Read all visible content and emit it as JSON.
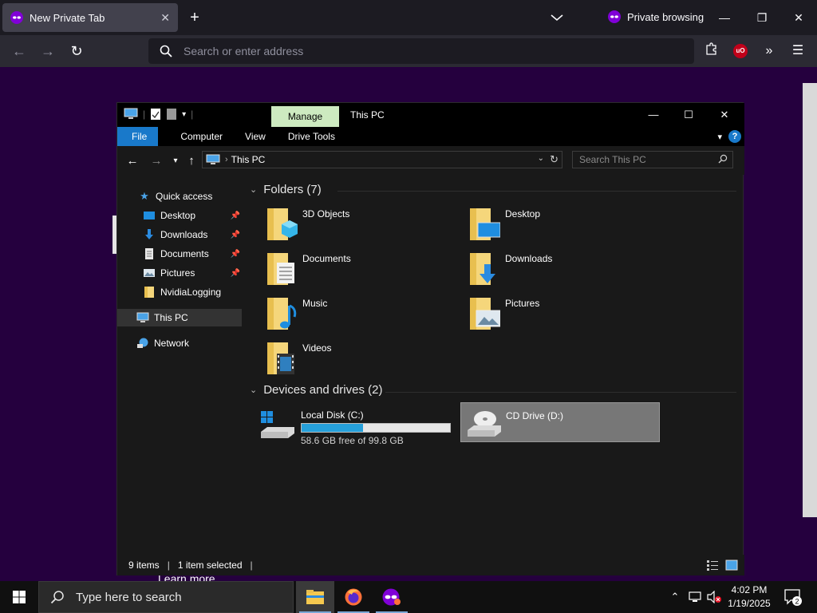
{
  "firefox": {
    "tab_title": "New Private Tab",
    "private_label": "Private browsing",
    "url_placeholder": "Search or enter address",
    "page_text": "Learn more",
    "ublock_badge": "uO"
  },
  "explorer": {
    "ribbon_context_tab": "Manage",
    "window_title": "This PC",
    "ribbon_tabs": [
      "File",
      "Computer",
      "View",
      "Drive Tools"
    ],
    "address_crumb": "This PC",
    "search_placeholder": "Search This PC",
    "nav": {
      "quick_access": "Quick access",
      "desktop": "Desktop",
      "downloads": "Downloads",
      "documents": "Documents",
      "pictures": "Pictures",
      "nvidia": "NvidiaLogging",
      "this_pc": "This PC",
      "network": "Network"
    },
    "folders_header": "Folders (7)",
    "folders": [
      "3D Objects",
      "Desktop",
      "Documents",
      "Downloads",
      "Music",
      "Pictures",
      "Videos"
    ],
    "devices_header": "Devices and drives (2)",
    "drives": {
      "c_name": "Local Disk (C:)",
      "c_free": "58.6 GB free of 99.8 GB",
      "c_used_fraction": 0.413,
      "d_name": "CD Drive (D:)"
    },
    "status": {
      "items": "9 items",
      "selected": "1 item selected"
    }
  },
  "taskbar": {
    "search_text": "Type here to search",
    "time": "4:02 PM",
    "date": "1/19/2025",
    "notification_count": "2"
  },
  "colors": {
    "firefox_private_bg": "#25003e",
    "accent": "#1979ca",
    "manage_tab": "#cdeac0",
    "progress": "#26a0da"
  }
}
